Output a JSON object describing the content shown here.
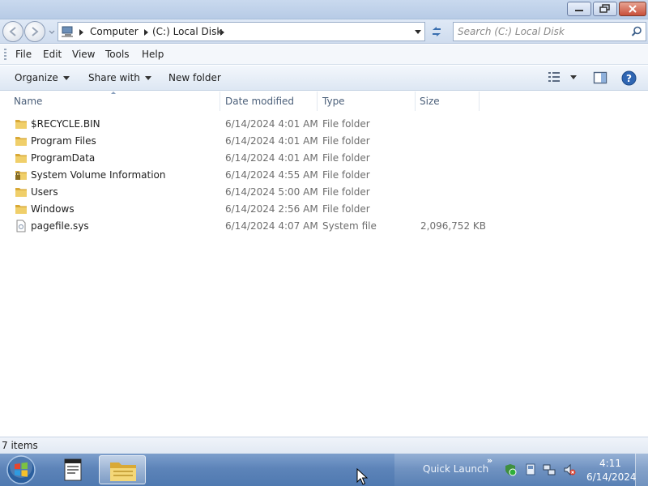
{
  "window": {
    "controls": {
      "minimize_icon": "minimize-icon",
      "restore_icon": "restore-icon",
      "close_icon": "close-icon"
    }
  },
  "address": {
    "crumbs": [
      "Computer",
      "(C:) Local Disk"
    ]
  },
  "search": {
    "placeholder": "Search (C:) Local Disk"
  },
  "menu": {
    "items": [
      "File",
      "Edit",
      "View",
      "Tools",
      "Help"
    ]
  },
  "toolbar": {
    "organize": "Organize",
    "share_with": "Share with",
    "new_folder": "New folder"
  },
  "columns": {
    "name": "Name",
    "date": "Date modified",
    "type": "Type",
    "size": "Size"
  },
  "files": [
    {
      "name": "$RECYCLE.BIN",
      "date": "6/14/2024 4:01 AM",
      "type": "File folder",
      "size": "",
      "icon": "folder-icon"
    },
    {
      "name": "Program Files",
      "date": "6/14/2024 4:01 AM",
      "type": "File folder",
      "size": "",
      "icon": "folder-icon"
    },
    {
      "name": "ProgramData",
      "date": "6/14/2024 4:01 AM",
      "type": "File folder",
      "size": "",
      "icon": "folder-icon"
    },
    {
      "name": "System Volume Information",
      "date": "6/14/2024 4:55 AM",
      "type": "File folder",
      "size": "",
      "icon": "locked-folder-icon"
    },
    {
      "name": "Users",
      "date": "6/14/2024 5:00 AM",
      "type": "File folder",
      "size": "",
      "icon": "folder-icon"
    },
    {
      "name": "Windows",
      "date": "6/14/2024 2:56 AM",
      "type": "File folder",
      "size": "",
      "icon": "folder-icon"
    },
    {
      "name": "pagefile.sys",
      "date": "6/14/2024 4:07 AM",
      "type": "System file",
      "size": "2,096,752 KB",
      "icon": "system-file-icon"
    }
  ],
  "status": {
    "items_count": "7 items"
  },
  "taskbar": {
    "quick_launch": "Quick Launch",
    "quick_launch_chevron": "»",
    "clock_time": "4:11",
    "clock_date": "6/14/2024"
  },
  "colors": {
    "titlebar": "#c9d9ee",
    "taskbar": "#5d84b9",
    "folder": "#e8c25a"
  }
}
